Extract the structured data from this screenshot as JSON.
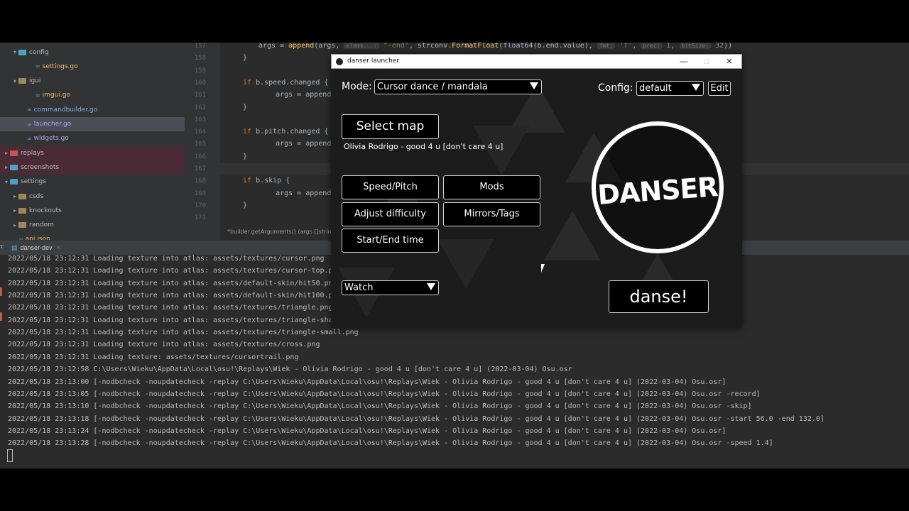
{
  "project_tree": {
    "items": [
      {
        "indent": 1,
        "chevron": "▾",
        "kind": "folder",
        "label": "config"
      },
      {
        "indent": 3,
        "chevron": "",
        "kind": "go",
        "label": "settings.go"
      },
      {
        "indent": 1,
        "chevron": "▾",
        "kind": "folder",
        "label": "igui"
      },
      {
        "indent": 3,
        "chevron": "",
        "kind": "go",
        "label": "imgui.go"
      },
      {
        "indent": 2,
        "chevron": "",
        "kind": "go",
        "label": "commandbuilder.go"
      },
      {
        "indent": 2,
        "chevron": "",
        "kind": "go",
        "label": "launcher.go"
      },
      {
        "indent": 2,
        "chevron": "",
        "kind": "go",
        "label": "widgets.go"
      },
      {
        "indent": 0,
        "chevron": "▸",
        "kind": "folder",
        "label": "replays"
      },
      {
        "indent": 0,
        "chevron": "▸",
        "kind": "folder",
        "label": "screenshots"
      },
      {
        "indent": 0,
        "chevron": "▾",
        "kind": "folder",
        "label": "settings"
      },
      {
        "indent": 1,
        "chevron": "▸",
        "kind": "folder",
        "label": "csds"
      },
      {
        "indent": 1,
        "chevron": "▸",
        "kind": "folder",
        "label": "knockouts"
      },
      {
        "indent": 1,
        "chevron": "▸",
        "kind": "folder",
        "label": "random"
      },
      {
        "indent": 1,
        "chevron": "",
        "kind": "go",
        "label": "api.json"
      }
    ]
  },
  "editor": {
    "line_numbers": [
      "157",
      "158",
      "159",
      "160",
      "161",
      "162",
      "163",
      "164",
      "165",
      "166",
      "167",
      "168",
      "169",
      "170",
      "171"
    ],
    "code": [
      {
        "pre": "args = ",
        "fn": "append",
        "rest": "(args, ",
        "hint1": "elems...:",
        "str": "\"-end\"",
        "rest2": ", strconv.",
        "fn2": "FormatFloat",
        "rest3": "(float64(b.end.value), ",
        "hint2": "fmt:",
        "str2": "'f'",
        "rest4": ", ",
        "hint3": "prec:",
        "num": "1",
        "rest5": ", ",
        "hint4": "bitSize:",
        "num2": "32",
        "end": "))"
      },
      {
        "text": "}"
      },
      {
        "text": ""
      },
      {
        "kw": "if",
        "text": " b.speed.changed {"
      },
      {
        "text": "    args = append(args"
      },
      {
        "text": "}"
      },
      {
        "text": ""
      },
      {
        "kw": "if",
        "text": " b.pitch.changed {"
      },
      {
        "text": "    args = append(args"
      },
      {
        "text": "}"
      },
      {
        "text": ""
      },
      {
        "kw": "if",
        "text": " b.skip {"
      },
      {
        "text": "    args = append(args"
      },
      {
        "text": "}"
      },
      {
        "text": ""
      }
    ],
    "breadcrumb": "*builder.getArguments() (args []string)"
  },
  "run_panel": {
    "label": "n:",
    "tab_label": "danser-dev",
    "tab_close": "×",
    "log": [
      "2022/05/18 23:12:31 Loading texture into atlas: assets/textures/cursor.png",
      "2022/05/18 23:12:31 Loading texture into atlas: assets/textures/cursor-top.png",
      "2022/05/18 23:12:31 Loading texture into atlas: assets/default-skin/hit50.png",
      "2022/05/18 23:12:31 Loading texture into atlas: assets/default-skin/hit100.png",
      "2022/05/18 23:12:31 Loading texture into atlas: assets/textures/triangle.png",
      "2022/05/18 23:12:31 Loading texture into atlas: assets/textures/triangle-shadow",
      "2022/05/18 23:12:31 Loading texture into atlas: assets/textures/triangle-small.png",
      "2022/05/18 23:12:31 Loading texture into atlas: assets/textures/cross.png",
      "2022/05/18 23:12:31 Loading texture: assets/textures/cursortrail.png",
      "2022/05/18 23:12:58 C:\\Users\\Wieku\\AppData\\Local\\osu!\\Replays\\Wiek - Olivia Rodrigo - good 4 u [don't care 4 u] (2022-03-04) Osu.osr",
      "2022/05/18 23:13:00 [-nodbcheck -noupdatecheck -replay C:\\Users\\Wieku\\AppData\\Local\\osu!\\Replays\\Wiek - Olivia Rodrigo - good 4 u [don't care 4 u] (2022-03-04) Osu.osr]",
      "2022/05/18 23:13:05 [-nodbcheck -noupdatecheck -replay C:\\Users\\Wieku\\AppData\\Local\\osu!\\Replays\\Wiek - Olivia Rodrigo - good 4 u [don't care 4 u] (2022-03-04) Osu.osr -record]",
      "2022/05/18 23:13:10 [-nodbcheck -noupdatecheck -replay C:\\Users\\Wieku\\AppData\\Local\\osu!\\Replays\\Wiek - Olivia Rodrigo - good 4 u [don't care 4 u] (2022-03-04) Osu.osr -skip]",
      "2022/05/18 23:13:18 [-nodbcheck -noupdatecheck -replay C:\\Users\\Wieku\\AppData\\Local\\osu!\\Replays\\Wiek - Olivia Rodrigo - good 4 u [don't care 4 u] (2022-03-04) Osu.osr -start 56.0 -end 132.0]",
      "2022/05/18 23:13:24 [-nodbcheck -noupdatecheck -replay C:\\Users\\Wieku\\AppData\\Local\\osu!\\Replays\\Wiek - Olivia Rodrigo - good 4 u [don't care 4 u] (2022-03-04) Osu.osr]",
      "2022/05/18 23:13:28 [-nodbcheck -noupdatecheck -replay C:\\Users\\Wieku\\AppData\\Local\\osu!\\Replays\\Wiek - Olivia Rodrigo - good 4 u [don't care 4 u] (2022-03-04) Osu.osr -speed 1.4]"
    ]
  },
  "launcher": {
    "title": "danser launcher",
    "min": "—",
    "max": "□",
    "close": "✕",
    "mode_label": "Mode:",
    "mode_value": "Cursor dance / mandala",
    "config_label": "Config:",
    "config_value": "default",
    "edit": "Edit",
    "select_map": "Select map",
    "map_name": "Olivia Rodrigo - good 4 u [don't care 4 u]",
    "speed_pitch": "Speed/Pitch",
    "mods": "Mods",
    "adjust_difficulty": "Adjust difficulty",
    "mirrors_tags": "Mirrors/Tags",
    "start_end_time": "Start/End time",
    "watch": "Watch",
    "logo": "DANSER",
    "dance": "danse!"
  }
}
